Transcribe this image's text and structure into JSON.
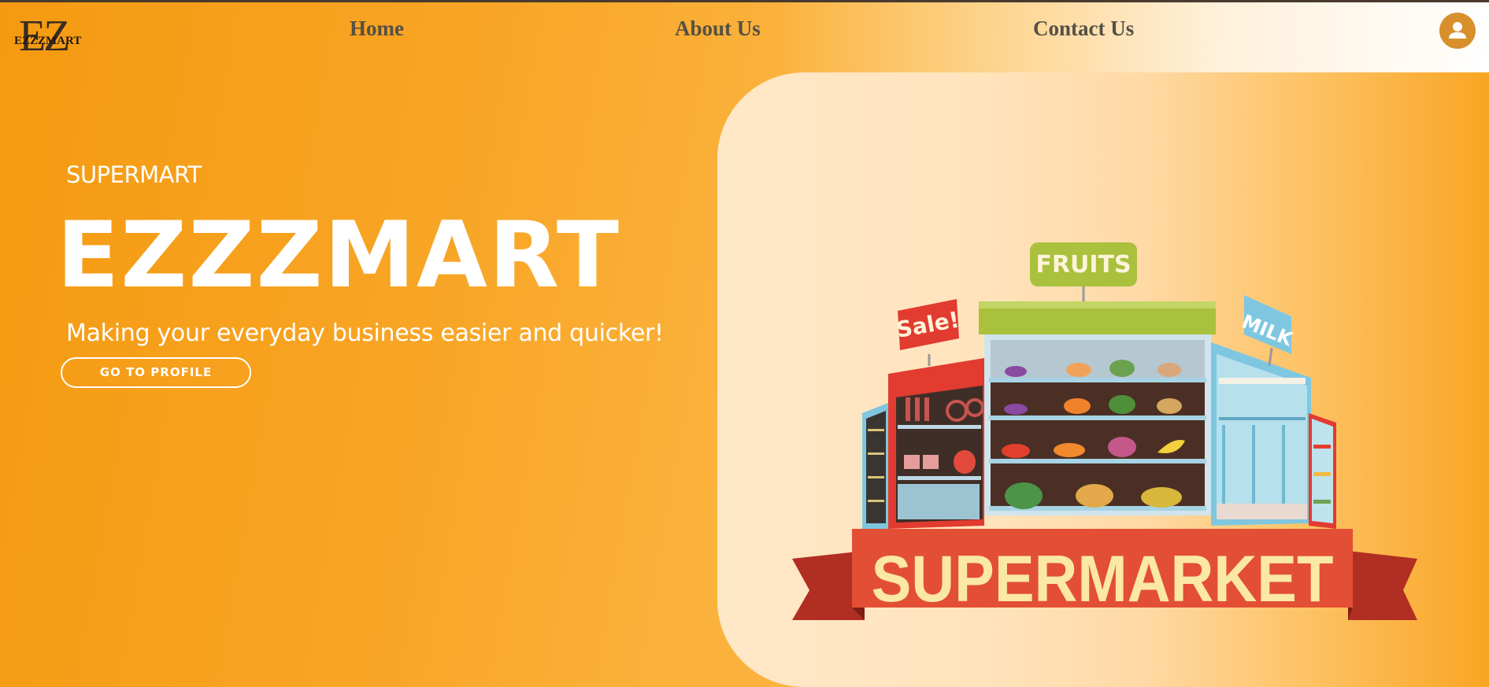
{
  "nav": {
    "logo_mark": "EZ",
    "logo_text": "EZZZMART",
    "links": [
      {
        "label": "Home"
      },
      {
        "label": "About Us"
      },
      {
        "label": "Contact Us"
      }
    ],
    "profile_icon": "user-avatar-icon"
  },
  "hero": {
    "subtitle": "SUPERMART",
    "title": "EZZZMART",
    "tagline": "Making your everyday business easier and quicker!",
    "cta_label": "GO TO PROFILE"
  },
  "illustration": {
    "signs": {
      "sale": "Sale!",
      "fruits": "FRUITS",
      "milk": "MILK"
    },
    "banner": "SUPERMARKET"
  },
  "colors": {
    "primary_orange": "#f59a10",
    "panel_cream": "#ffe8c8",
    "text_white": "#ffffff",
    "nav_text": "#555045",
    "banner_red": "#e34f34"
  }
}
